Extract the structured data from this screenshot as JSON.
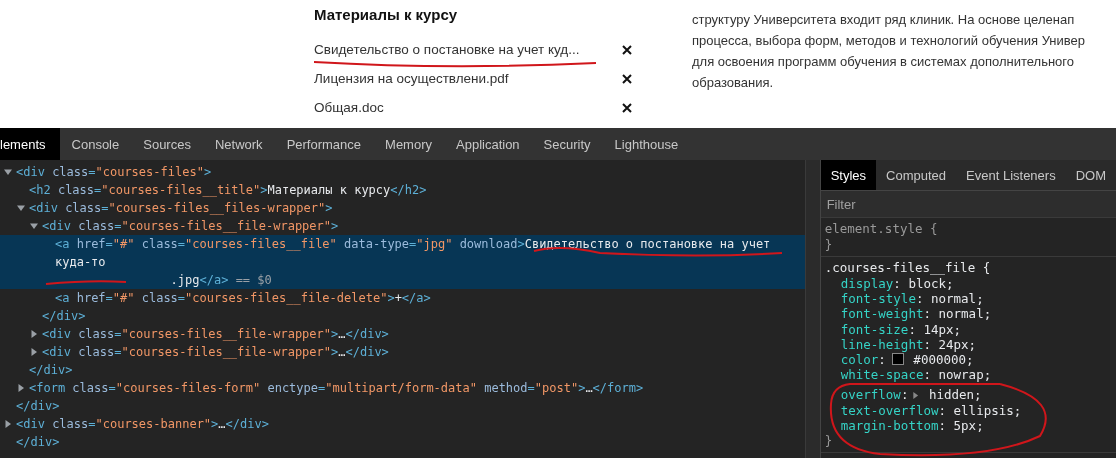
{
  "page": {
    "files_title": "Материалы к курсу",
    "files": [
      {
        "name": "Свидетельство о постановке на учет куд..."
      },
      {
        "name": "Лицензия на осуществлени.pdf"
      },
      {
        "name": "Общая.doc"
      }
    ],
    "text_lines": [
      "структуру Университета входит ряд клиник. На основе целенап",
      "процесса, выбора форм, методов и технологий обучения Универ",
      "для освоения программ обучения в системах дополнительного",
      "образования."
    ]
  },
  "devtools": {
    "tabs": [
      {
        "label": "lements",
        "selected": true
      },
      {
        "label": "Console",
        "selected": false
      },
      {
        "label": "Sources",
        "selected": false
      },
      {
        "label": "Network",
        "selected": false
      },
      {
        "label": "Performance",
        "selected": false
      },
      {
        "label": "Memory",
        "selected": false
      },
      {
        "label": "Application",
        "selected": false
      },
      {
        "label": "Security",
        "selected": false
      },
      {
        "label": "Lighthouse",
        "selected": false
      }
    ],
    "dom_tree": [
      {
        "close": "</div>",
        "children": [
          {
            "expanded": true,
            "selected": false,
            "line": "<div class=\"courses-files\">",
            "close": "</div>",
            "children": [
              {
                "selected": false,
                "line": "<h2 class=\"courses-files__title\">Материалы к курсу</h2>"
              },
              {
                "expanded": true,
                "selected": false,
                "line": "<div class=\"courses-files__files-wrapper\">",
                "close": "</div>",
                "children": [
                  {
                    "expanded": true,
                    "selected": false,
                    "line": "<div class=\"courses-files__file-wrapper\">",
                    "close": "</div>",
                    "children": [
                      {
                        "selected": true,
                        "line": "<a href=\"#\" class=\"courses-files__file\" data-type=\"jpg\" download>Свидетельство о постановке на учет куда-то\n                .jpg</a>",
                        "ref": " == $0"
                      },
                      {
                        "selected": false,
                        "line": "<a href=\"#\" class=\"courses-files__file-delete\">+</a>"
                      }
                    ]
                  },
                  {
                    "expanded": false,
                    "selected": false,
                    "line": "<div class=\"courses-files__file-wrapper\">…</div>"
                  },
                  {
                    "expanded": false,
                    "selected": false,
                    "line": "<div class=\"courses-files__file-wrapper\">…</div>"
                  }
                ]
              },
              {
                "expanded": false,
                "selected": false,
                "line": "<form class=\"courses-files-form\" enctype=\"multipart/form-data\" method=\"post\">…</form>"
              }
            ]
          },
          {
            "expanded": false,
            "selected": false,
            "line": "<div class=\"courses-banner\">…</div>"
          }
        ]
      }
    ],
    "styles": {
      "tabs": [
        {
          "label": "Styles",
          "selected": true
        },
        {
          "label": "Computed",
          "selected": false
        },
        {
          "label": "Event Listeners",
          "selected": false
        },
        {
          "label": "DOM",
          "selected": false
        }
      ],
      "filter": {
        "placeholder": "Filter"
      },
      "rules": [
        {
          "selector": "element.style {",
          "kind": "inline",
          "close": "}"
        },
        {
          "selector": ".courses-files__file {",
          "kind": "author",
          "close": "}",
          "declarations": [
            {
              "text": "display: block;",
              "kind": "plain"
            },
            {
              "text": "font-style: normal;",
              "kind": "plain"
            },
            {
              "text": "font-weight: normal;",
              "kind": "plain"
            },
            {
              "text": "font-size: 14px;",
              "kind": "plain"
            },
            {
              "text": "line-height: 24px;",
              "kind": "plain"
            },
            {
              "text": "color: #000000;",
              "kind": "color"
            },
            {
              "text": "white-space: nowrap;",
              "kind": "plain"
            },
            {
              "text": "overflow: hidden;",
              "kind": "shorthand"
            },
            {
              "text": "text-overflow: ellipsis;",
              "kind": "plain"
            },
            {
              "text": "margin-bottom: 5px;",
              "kind": "plain"
            }
          ]
        }
      ]
    }
  }
}
